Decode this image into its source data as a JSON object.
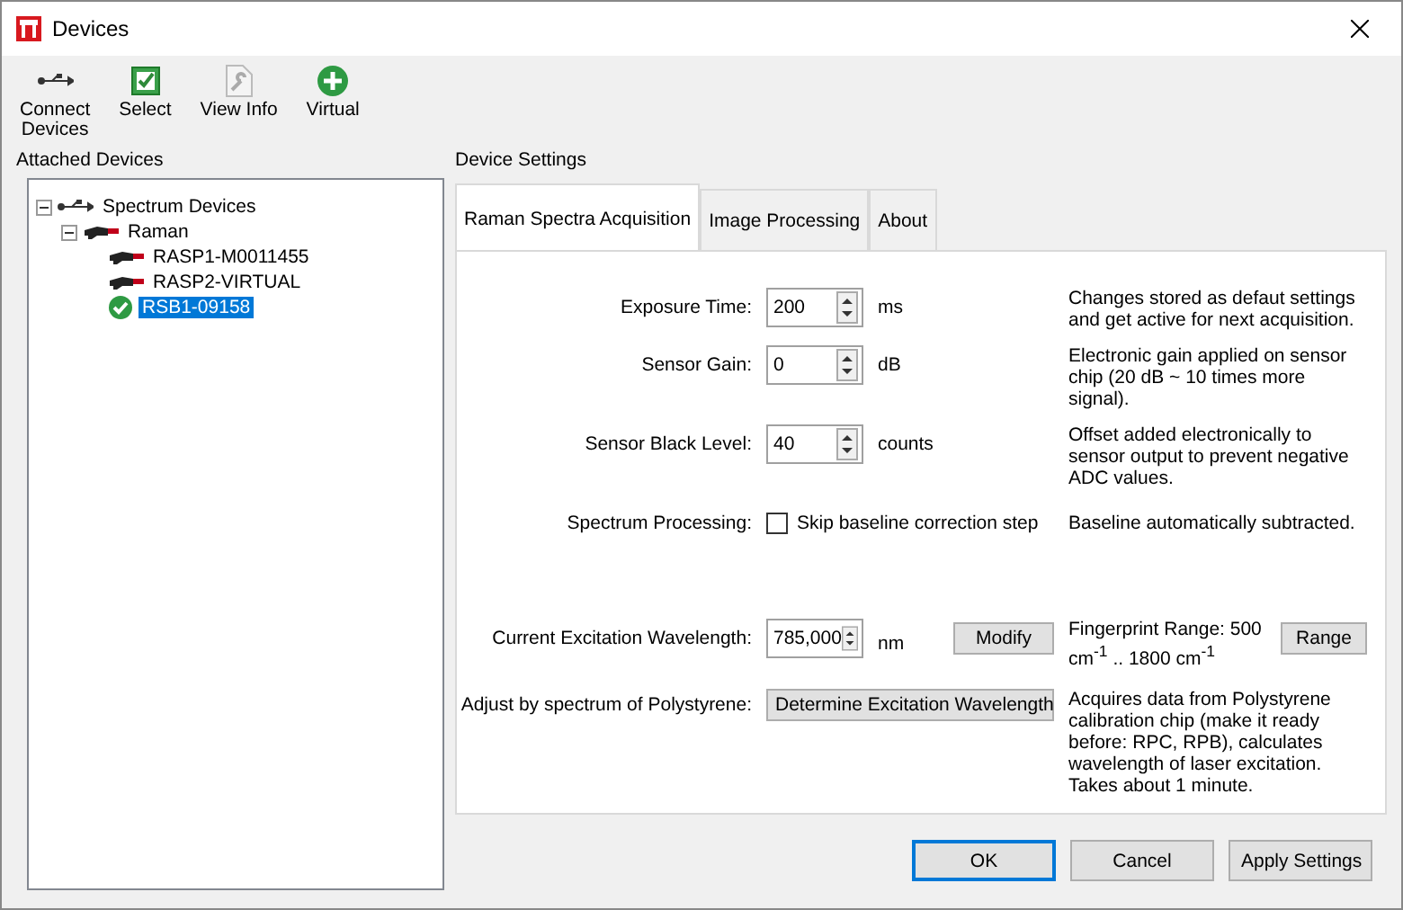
{
  "window": {
    "title": "Devices"
  },
  "toolbar": [
    {
      "kind": "usb",
      "label": "Connect\nDevices"
    },
    {
      "kind": "select",
      "label": "Select"
    },
    {
      "kind": "info",
      "label": "View Info"
    },
    {
      "kind": "add",
      "label": "Virtual"
    }
  ],
  "attached_devices": {
    "title": "Attached Devices",
    "tree": [
      {
        "label": "Spectrum Devices",
        "kind": "usb",
        "expanded": true,
        "selected": false,
        "children": [
          {
            "label": "Raman",
            "kind": "device",
            "expanded": true,
            "selected": false,
            "children": [
              {
                "label": "RASP1-M0011455",
                "kind": "device",
                "selected": false
              },
              {
                "label": "RASP2-VIRTUAL",
                "kind": "device",
                "selected": false
              },
              {
                "label": "RSB1-09158",
                "kind": "active",
                "selected": true
              }
            ]
          }
        ]
      }
    ]
  },
  "device_settings": {
    "title": "Device Settings",
    "tabs": [
      {
        "label": "Raman Spectra Acquisition",
        "selected": true
      },
      {
        "label": "Image Processing",
        "selected": false
      },
      {
        "label": "About",
        "selected": false
      }
    ],
    "rows": [
      {
        "kind": "spin",
        "label": "Exposure Time:",
        "value": "200",
        "unit": "ms",
        "note": "Changes stored as defaut settings and get active for next acquisition."
      },
      {
        "kind": "spin",
        "label": "Sensor Gain:",
        "value": "0",
        "unit": "dB",
        "note": "Electronic gain applied on sensor chip (20 dB ~ 10 times more signal)."
      },
      {
        "kind": "spin",
        "label": "Sensor Black Level:",
        "value": "40",
        "unit": "counts",
        "note": "Offset added electronically to sensor output to prevent negative ADC values."
      },
      {
        "kind": "checkbox",
        "label": "Spectrum Processing:",
        "text": "Skip baseline correction step",
        "checked": false,
        "note": "Baseline automatically subtracted."
      },
      {
        "kind": "spin_button",
        "label": "Current Excitation Wavelength:",
        "value": "785,000",
        "unit": "nm",
        "button": "Modify",
        "note": "Fingerprint Range: 500 cm$^{-1}$ .. 1800 cm$^{-1}$",
        "button2": "Range"
      },
      {
        "kind": "wide_button",
        "label": "Adjust by spectrum of Polystyrene:",
        "button": "Determine Excitation Wavelength",
        "note": "Acquires data from Polystyrene calibration chip (make it ready before: RPC, RPB), calculates wavelength of laser excitation. Takes about 1 minute."
      }
    ]
  },
  "buttons": [
    {
      "label": "OK",
      "default": true
    },
    {
      "label": "Cancel",
      "default": false
    },
    {
      "label": "Apply Settings",
      "default": false
    }
  ]
}
